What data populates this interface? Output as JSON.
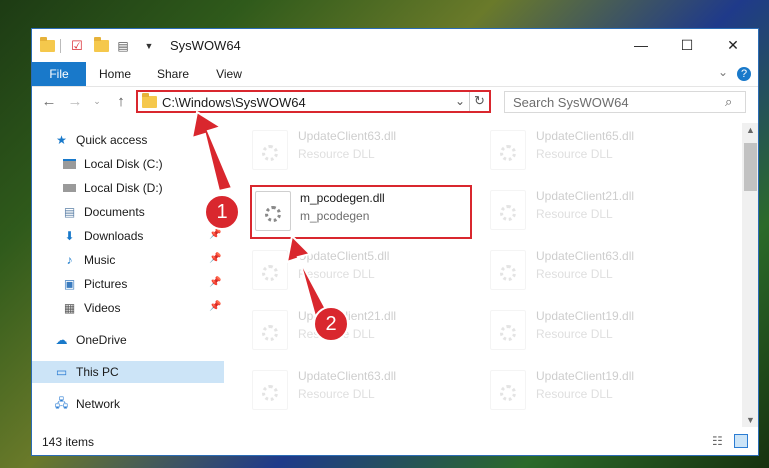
{
  "window": {
    "title": "SysWOW64",
    "controls": {
      "minimize": "—",
      "maximize": "☐",
      "close": "✕"
    }
  },
  "ribbon": {
    "tabs": [
      {
        "label": "File"
      },
      {
        "label": "Home"
      },
      {
        "label": "Share"
      },
      {
        "label": "View"
      }
    ],
    "expand_symbol": "⌄",
    "help_symbol": "?"
  },
  "address_bar": {
    "path": "C:\\Windows\\SysWOW64"
  },
  "search": {
    "placeholder": "Search SysWOW64"
  },
  "nav": {
    "items": [
      {
        "label": "Quick access"
      },
      {
        "label": "Local Disk (C:)"
      },
      {
        "label": "Local Disk (D:)"
      },
      {
        "label": "Documents"
      },
      {
        "label": "Downloads"
      },
      {
        "label": "Music"
      },
      {
        "label": "Pictures"
      },
      {
        "label": "Videos"
      },
      {
        "label": "OneDrive"
      },
      {
        "label": "This PC"
      },
      {
        "label": "Network"
      }
    ]
  },
  "files": [
    {
      "name": "UpdateClient63.dll",
      "type": "Resource DLL"
    },
    {
      "name": "UpdateClient65.dll",
      "type": "Resource DLL"
    },
    {
      "name": "UpdateClient21.dll",
      "type": "Resource DLL"
    },
    {
      "name": "UpdateClient5.dll",
      "type": "Resource DLL"
    },
    {
      "name": "UpdateClient63.dll",
      "type": "Resource DLL"
    },
    {
      "name": "UpdateClient21.dll",
      "type": "Resource DLL"
    },
    {
      "name": "UpdateClient19.dll",
      "type": "Resource DLL"
    },
    {
      "name": "UpdateClient63.dll",
      "type": "Resource DLL"
    },
    {
      "name": "UpdateClient19.dll",
      "type": "Resource DLL"
    }
  ],
  "highlighted_file": {
    "name": "m_pcodegen.dll",
    "description": "m_pcodegen"
  },
  "annotations": {
    "step1": "1",
    "step2": "2"
  },
  "status": {
    "item_count": "143 items"
  },
  "colors": {
    "accent": "#1979ca",
    "highlight": "#d9272e",
    "selected_nav": "#cce4f7"
  }
}
